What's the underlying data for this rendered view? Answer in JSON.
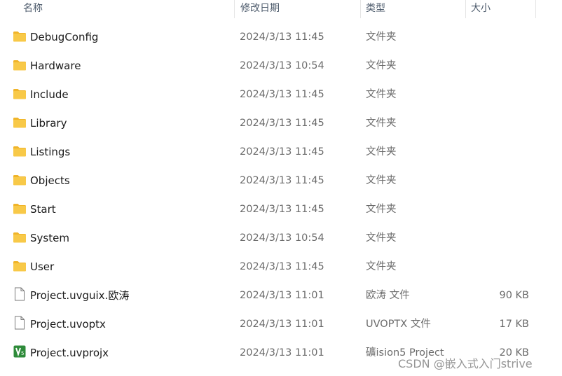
{
  "columns": {
    "name": "名称",
    "date": "修改日期",
    "type": "类型",
    "size": "大小"
  },
  "rows": [
    {
      "name": "DebugConfig",
      "date": "2024/3/13 11:45",
      "type": "文件夹",
      "size": "",
      "icon": "folder-icon"
    },
    {
      "name": "Hardware",
      "date": "2024/3/13 10:54",
      "type": "文件夹",
      "size": "",
      "icon": "folder-icon"
    },
    {
      "name": "Include",
      "date": "2024/3/13 11:45",
      "type": "文件夹",
      "size": "",
      "icon": "folder-icon"
    },
    {
      "name": "Library",
      "date": "2024/3/13 11:45",
      "type": "文件夹",
      "size": "",
      "icon": "folder-icon"
    },
    {
      "name": "Listings",
      "date": "2024/3/13 11:45",
      "type": "文件夹",
      "size": "",
      "icon": "folder-icon"
    },
    {
      "name": "Objects",
      "date": "2024/3/13 11:45",
      "type": "文件夹",
      "size": "",
      "icon": "folder-icon"
    },
    {
      "name": "Start",
      "date": "2024/3/13 11:45",
      "type": "文件夹",
      "size": "",
      "icon": "folder-icon"
    },
    {
      "name": "System",
      "date": "2024/3/13 10:54",
      "type": "文件夹",
      "size": "",
      "icon": "folder-icon"
    },
    {
      "name": "User",
      "date": "2024/3/13 11:45",
      "type": "文件夹",
      "size": "",
      "icon": "folder-icon"
    },
    {
      "name": "Project.uvguix.欧涛",
      "date": "2024/3/13 11:01",
      "type": "欧涛 文件",
      "size": "90 KB",
      "icon": "file-icon"
    },
    {
      "name": "Project.uvoptx",
      "date": "2024/3/13 11:01",
      "type": "UVOPTX 文件",
      "size": "17 KB",
      "icon": "file-icon"
    },
    {
      "name": "Project.uvprojx",
      "date": "2024/3/13 11:01",
      "type": "礦ision5 Project",
      "size": "20 KB",
      "icon": "keil-project-icon"
    }
  ],
  "watermark": "CSDN @嵌入式入门strive",
  "colors": {
    "folder_body": "#f8c948",
    "folder_tab": "#f0b429",
    "keil_green": "#2e8b3a",
    "header_text": "#4c5a6b",
    "detail_text": "#6b6b6b"
  }
}
